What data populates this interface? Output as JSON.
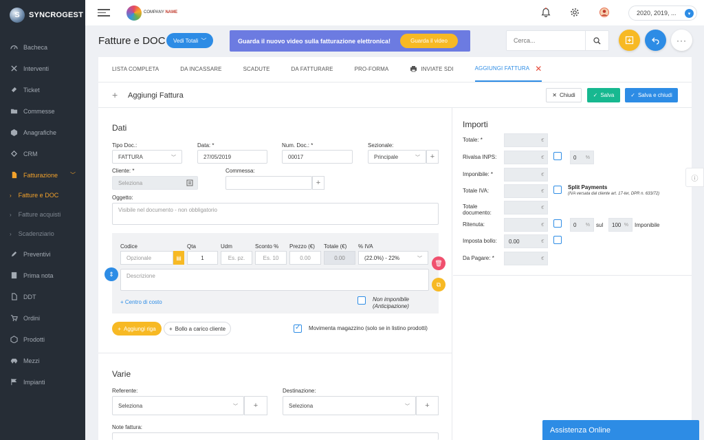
{
  "app": {
    "name": "SYNCROGEST",
    "logo_letter": "S"
  },
  "sidebar": {
    "items": [
      {
        "label": "Bacheca",
        "icon": "speedometer-icon"
      },
      {
        "label": "Interventi",
        "icon": "tools-icon"
      },
      {
        "label": "Ticket",
        "icon": "ticket-icon"
      },
      {
        "label": "Commesse",
        "icon": "folder-icon"
      },
      {
        "label": "Anagrafiche",
        "icon": "box-icon"
      },
      {
        "label": "CRM",
        "icon": "handshake-icon"
      },
      {
        "label": "Fatturazione",
        "icon": "document-icon"
      },
      {
        "label": "Fatture e DOC"
      },
      {
        "label": "Fatture acquisti"
      },
      {
        "label": "Scadenziario"
      },
      {
        "label": "Preventivi",
        "icon": "edit-icon"
      },
      {
        "label": "Prima nota",
        "icon": "note-icon"
      },
      {
        "label": "DDT",
        "icon": "file-icon"
      },
      {
        "label": "Ordini",
        "icon": "cart-icon"
      },
      {
        "label": "Prodotti",
        "icon": "package-icon"
      },
      {
        "label": "Mezzi",
        "icon": "car-icon"
      },
      {
        "label": "Impianti",
        "icon": "flag-icon"
      }
    ]
  },
  "topbar": {
    "brand_small": "COMPANY",
    "brand_name": "NAME",
    "years": "2020, 2019, ..."
  },
  "header": {
    "title": "Fatture e DOC",
    "vedi_totali": "Vedi Totali",
    "banner_text": "Guarda il nuovo video sulla fatturazione elettronica!",
    "banner_button": "Guarda il video",
    "search_placeholder": "Cerca..."
  },
  "tabs": [
    "LISTA COMPLETA",
    "DA INCASSARE",
    "SCADUTE",
    "DA FATTURARE",
    "PRO-FORMA",
    "INVIATE SDI",
    "AGGIUNGI FATTURA"
  ],
  "form": {
    "title": "Aggiungi Fattura",
    "chiudi": "Chiudi",
    "salva": "Salva",
    "salva_chiudi": "Salva e chiudi"
  },
  "dati": {
    "section": "Dati",
    "tipo_label": "Tipo Doc.:",
    "tipo_value": "FATTURA",
    "data_label": "Data: *",
    "data_value": "27/05/2019",
    "num_label": "Num. Doc.: *",
    "num_value": "00017",
    "sez_label": "Sezionale:",
    "sez_value": "Principale",
    "cliente_label": "Cliente: *",
    "cliente_value": "Seleziona",
    "commessa_label": "Commessa:",
    "oggetto_label": "Oggetto:",
    "oggetto_placeholder": "Visibile nel documento - non obbligatorio"
  },
  "riga": {
    "codice": "Codice",
    "codice_ph": "Opzionale",
    "qta": "Qta",
    "qta_val": "1",
    "udm": "Udm",
    "udm_ph": "Es. pz.",
    "sconto": "Sconto %",
    "sconto_ph": "Es. 10",
    "prezzo": "Prezzo (€)",
    "prezzo_ph": "0.00",
    "totale": "Totale (€)",
    "totale_val": "0.00",
    "iva": "% IVA",
    "iva_val": "(22.0%) - 22%",
    "descrizione_ph": "Descrizione",
    "centro_costo": "+ Centro di costo",
    "non_imponibile": "Non imponibile (Anticipazione)"
  },
  "actions": {
    "aggiungi_riga": "Aggiungi riga",
    "bollo": "Bollo a carico cliente",
    "movimenta": "Movimenta magazzino (solo se in listino prodotti)"
  },
  "varie": {
    "section": "Varie",
    "referente_label": "Referente:",
    "referente_value": "Seleziona",
    "destinazione_label": "Destinazione:",
    "destinazione_value": "Seleziona",
    "note_label": "Note fattura:"
  },
  "importi": {
    "section": "Importi",
    "totale": "Totale: *",
    "rivalsa": "Rivalsa INPS:",
    "rivalsa_pct": "0",
    "imponibile": "Imponibile: *",
    "totale_iva": "Totale IVA:",
    "split_title": "Split Payments",
    "split_note": "(IVA versata dal cliente art. 17-ter, DPR n. 633/72)",
    "totale_doc": "Totale documento:",
    "ritenuta": "Ritenuta:",
    "rit_pct": "0",
    "sul": "sul",
    "sul_pct": "100",
    "imponibile_word": "Imponibile",
    "bollo": "Imposta bollo:",
    "bollo_val": "0.00",
    "da_pagare": "Da Pagare: *",
    "euro": "€",
    "pct": "%"
  },
  "assistenza": "Assistenza Online",
  "colors": {
    "accent": "#2d8ce5",
    "orange": "#f3a22b",
    "green": "#17b890",
    "banner": "#6c7be1",
    "sidebar": "#262d36"
  }
}
